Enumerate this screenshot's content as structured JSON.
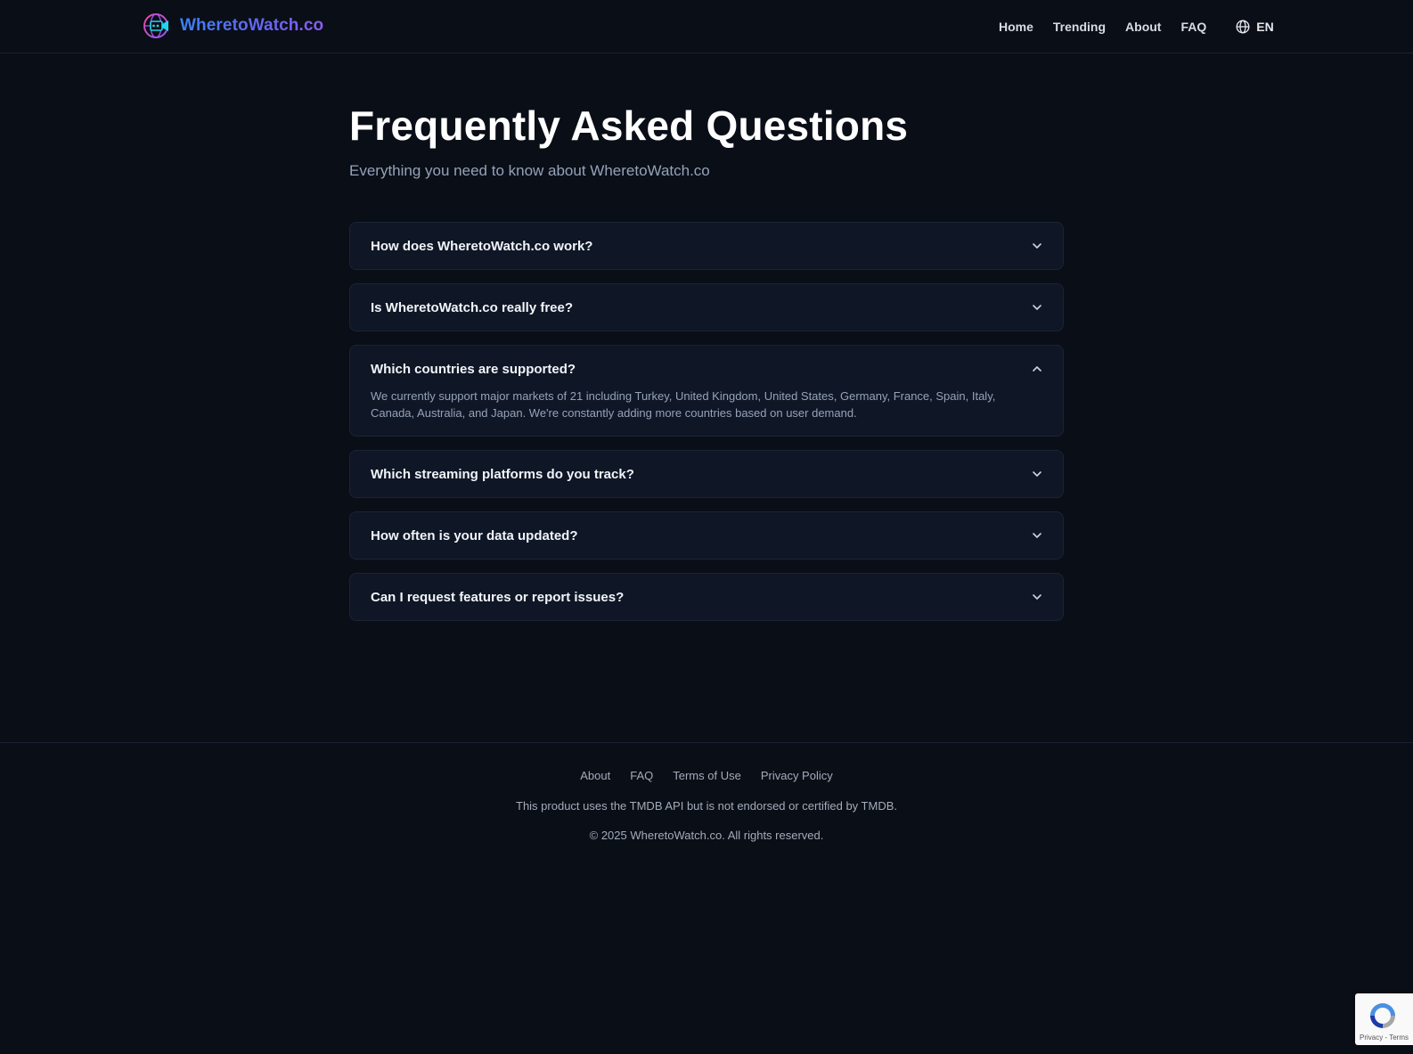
{
  "header": {
    "brand": "WheretoWatch.co",
    "nav": [
      "Home",
      "Trending",
      "About",
      "FAQ"
    ],
    "language": "EN",
    "logo_icon": "globe-film-logo-icon",
    "language_icon": "globe-icon"
  },
  "main": {
    "title": "Frequently Asked Questions",
    "subtitle": "Everything you need to know about WheretoWatch.co",
    "faqs": [
      {
        "question": "How does WheretoWatch.co work?",
        "expanded": false,
        "icon": "chevron-down-icon"
      },
      {
        "question": "Is WheretoWatch.co really free?",
        "expanded": false,
        "icon": "chevron-down-icon"
      },
      {
        "question": "Which countries are supported?",
        "expanded": true,
        "icon": "chevron-up-icon",
        "answer": "We currently support major markets of 21 including Turkey, United Kingdom, United States, Germany, France, Spain, Italy, Canada, Australia, and Japan. We're constantly adding more countries based on user demand."
      },
      {
        "question": "Which streaming platforms do you track?",
        "expanded": false,
        "icon": "chevron-down-icon"
      },
      {
        "question": "How often is your data updated?",
        "expanded": false,
        "icon": "chevron-down-icon"
      },
      {
        "question": "Can I request features or report issues?",
        "expanded": false,
        "icon": "chevron-down-icon"
      }
    ]
  },
  "footer": {
    "links": [
      "About",
      "FAQ",
      "Terms of Use",
      "Privacy Policy"
    ],
    "tmdb_notice": "This product uses the TMDB API but is not endorsed or certified by TMDB.",
    "copyright": "© 2025 WheretoWatch.co. All rights reserved."
  },
  "recaptcha": {
    "links": "Privacy - Terms",
    "icon": "recaptcha-icon"
  },
  "colors": {
    "background": "#0a0e17",
    "card": "#0f1626",
    "brand_gradient_start": "#3b82f6",
    "brand_gradient_end": "#8b5cf6"
  }
}
